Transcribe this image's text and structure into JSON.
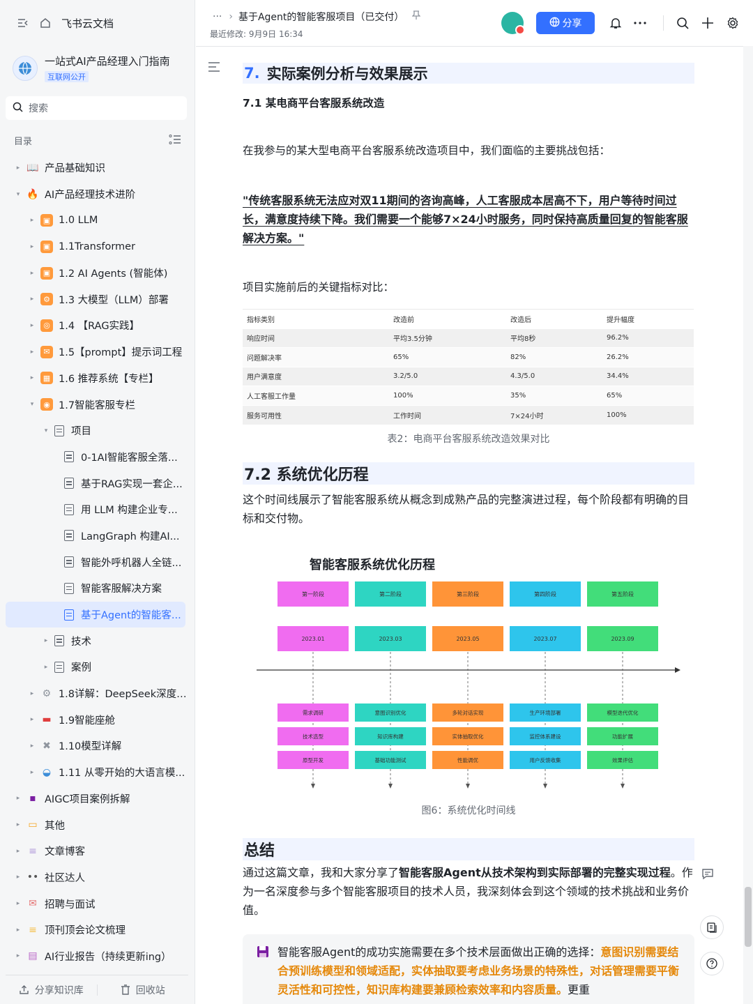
{
  "sidebar": {
    "brand": "飞书云文档",
    "wiki_title": "一站式AI产品经理入门指南",
    "wiki_badge": "互联网公开",
    "search_placeholder": "搜索",
    "toc_label": "目录",
    "items": [
      {
        "label": "产品基础知识",
        "level": 0,
        "arrow": "▸",
        "icon": "book-icon",
        "color": "#f5a623"
      },
      {
        "label": "AI产品经理技术进阶",
        "level": 0,
        "arrow": "▾",
        "icon": "flame-icon",
        "color": "#f5a623"
      },
      {
        "label": "1.0 LLM",
        "level": 1,
        "arrow": "▸",
        "icon": "cube-icon",
        "color": "#ff9a3c"
      },
      {
        "label": "1.1Transformer",
        "level": 1,
        "arrow": "▸",
        "icon": "cube-icon",
        "color": "#ff9a3c"
      },
      {
        "label": "1.2 AI Agents (智能体)",
        "level": 1,
        "arrow": "▸",
        "icon": "cube-icon",
        "color": "#ff9a3c"
      },
      {
        "label": "1.3 大模型（LLM）部署",
        "level": 1,
        "arrow": "▸",
        "icon": "gear-icon",
        "color": "#ff9a3c"
      },
      {
        "label": "1.4 【RAG实践】",
        "level": 1,
        "arrow": "▸",
        "icon": "target-icon",
        "color": "#ff9a3c"
      },
      {
        "label": "1.5【prompt】提示词工程",
        "level": 1,
        "arrow": "▸",
        "icon": "chat-icon",
        "color": "#ff9a3c"
      },
      {
        "label": "1.6 推荐系统【专栏】",
        "level": 1,
        "arrow": "▸",
        "icon": "grid-icon",
        "color": "#ff9a3c"
      },
      {
        "label": "1.7智能客服专栏",
        "level": 1,
        "arrow": "▾",
        "icon": "bulb-icon",
        "color": "#ff9a3c"
      },
      {
        "label": "项目",
        "level": 2,
        "arrow": "▾",
        "icon": "doc-icon",
        "color": ""
      },
      {
        "label": "0-1AI智能客服全落...",
        "level": 3,
        "arrow": "",
        "icon": "doc-icon",
        "color": ""
      },
      {
        "label": "基于RAG实现一套企...",
        "level": 3,
        "arrow": "",
        "icon": "doc-icon",
        "color": ""
      },
      {
        "label": "用 LLM 构建企业专...",
        "level": 3,
        "arrow": "",
        "icon": "doc-icon",
        "color": ""
      },
      {
        "label": "LangGraph 构建AI...",
        "level": 3,
        "arrow": "",
        "icon": "doc-icon",
        "color": ""
      },
      {
        "label": "智能外呼机器人全链...",
        "level": 3,
        "arrow": "",
        "icon": "doc-icon",
        "color": ""
      },
      {
        "label": "智能客服解决方案",
        "level": 3,
        "arrow": "",
        "icon": "doc-icon",
        "color": ""
      },
      {
        "label": "基于Agent的智能客...",
        "level": 3,
        "arrow": "",
        "icon": "doc-icon",
        "color": "",
        "active": true
      },
      {
        "label": "技术",
        "level": 2,
        "arrow": "▸",
        "icon": "doc-icon",
        "color": ""
      },
      {
        "label": "案例",
        "level": 2,
        "arrow": "▸",
        "icon": "doc-icon",
        "color": ""
      },
      {
        "label": "1.8详解：DeepSeek深度推...",
        "level": 1,
        "arrow": "▸",
        "icon": "gear-icon",
        "color": "#8f959e"
      },
      {
        "label": "1.9智能座舱",
        "level": 1,
        "arrow": "▸",
        "icon": "car-icon",
        "color": "#e03e3e"
      },
      {
        "label": "1.10模型详解",
        "level": 1,
        "arrow": "▸",
        "icon": "tools-icon",
        "color": "#8f959e"
      },
      {
        "label": "1.11 从零开始的大语言模...",
        "level": 1,
        "arrow": "▸",
        "icon": "ufo-icon",
        "color": "#3c8dd8"
      },
      {
        "label": "AIGC项目案例拆解",
        "level": 0,
        "arrow": "▸",
        "icon": "floppy-icon",
        "color": "#7b1fa2"
      },
      {
        "label": "其他",
        "level": 0,
        "arrow": "▸",
        "icon": "folder-icon",
        "color": "#f5a623"
      },
      {
        "label": "文章博客",
        "level": 0,
        "arrow": "▸",
        "icon": "memo-icon",
        "color": "#b39ddb"
      },
      {
        "label": "社区达人",
        "level": 0,
        "arrow": "▸",
        "icon": "eyes-icon",
        "color": "#555555"
      },
      {
        "label": "招聘与面试",
        "level": 0,
        "arrow": "▸",
        "icon": "mail-icon",
        "color": "#e57373"
      },
      {
        "label": "顶刊顶会论文梳理",
        "level": 0,
        "arrow": "▸",
        "icon": "scroll-icon",
        "color": "#f5c04a"
      },
      {
        "label": "AI行业报告（持续更新ing）",
        "level": 0,
        "arrow": "▸",
        "icon": "report-icon",
        "color": "#ba68c8"
      }
    ],
    "footer": {
      "share": "分享知识库",
      "trash": "回收站"
    }
  },
  "header": {
    "more": "···",
    "doc_title": "基于Agent的智能客服项目（已交付）",
    "modified": "最近修改: 9月9日 16:34",
    "share_label": "分享"
  },
  "content": {
    "h1_num": "7.",
    "h1_text": "实际案例分析与效果展示",
    "h3": "7.1 某电商平台客服系统改造",
    "p1": "在我参与的某大型电商平台客服系统改造项目中，我们面临的主要挑战包括：",
    "quote": "\"传统客服系统无法应对双11期间的咨询高峰，人工客服成本居高不下，用户等待时间过长，满意度持续下降。我们需要一个能够7×24小时服务，同时保持高质量回复的智能客服解决方案。\"",
    "p2": "项目实施前后的关键指标对比：",
    "table": {
      "headers": [
        "指标类别",
        "改造前",
        "改造后",
        "提升幅度"
      ],
      "rows": [
        [
          "响应时间",
          "平均3.5分钟",
          "平均8秒",
          "96.2%"
        ],
        [
          "问题解决率",
          "65%",
          "82%",
          "26.2%"
        ],
        [
          "用户满意度",
          "3.2/5.0",
          "4.3/5.0",
          "34.4%"
        ],
        [
          "人工客服工作量",
          "100%",
          "35%",
          "65%"
        ],
        [
          "服务可用性",
          "工作时间",
          "7×24小时",
          "100%"
        ]
      ]
    },
    "table_caption": "表2：电商平台客服系统改造效果对比",
    "h2": "7.2 系统优化历程",
    "p3": "这个时间线展示了智能客服系统从概念到成熟产品的完整演进过程，每个阶段都有明确的目标和交付物。",
    "timeline": {
      "title": "智能客服系统优化历程",
      "stages": [
        {
          "name": "第一阶段",
          "date": "2023.01",
          "color": "#f06cf0",
          "tasks": [
            "需求调研",
            "技术选型",
            "原型开发"
          ]
        },
        {
          "name": "第二阶段",
          "date": "2023.03",
          "color": "#2ed5c2",
          "tasks": [
            "意图识别优化",
            "知识库构建",
            "基础功能测试"
          ]
        },
        {
          "name": "第三阶段",
          "date": "2023.05",
          "color": "#ff9438",
          "tasks": [
            "多轮对话实现",
            "实体抽取优化",
            "性能调优"
          ]
        },
        {
          "name": "第四阶段",
          "date": "2023.07",
          "color": "#2ec5ec",
          "tasks": [
            "生产环境部署",
            "监控体系建设",
            "用户反馈收集"
          ]
        },
        {
          "name": "第五阶段",
          "date": "2023.09",
          "color": "#42dd7a",
          "tasks": [
            "模型迭代优化",
            "功能扩展",
            "效果评估"
          ]
        }
      ]
    },
    "figure_caption": "图6：系统优化时间线",
    "summary_title": "总结",
    "summary_p1": "通过这篇文章，我和大家分享了",
    "summary_bold": "智能客服Agent从技术架构到实际部署的完整实现过程",
    "summary_p2": "。作为一名深度参与多个智能客服项目的技术人员，我深刻体会到这个领域的技术挑战和业务价值。",
    "callout_plain": "智能客服Agent的成功实施需要在多个技术层面做出正确的选择：",
    "callout_hl": "意图识别需要结合预训练模型和领域适配，实体抽取要考虑业务场景的特殊性，对话管理需要平衡灵活性和可控性，知识库构建要兼顾检索效率和内容质量。",
    "callout_tail": "更重"
  }
}
